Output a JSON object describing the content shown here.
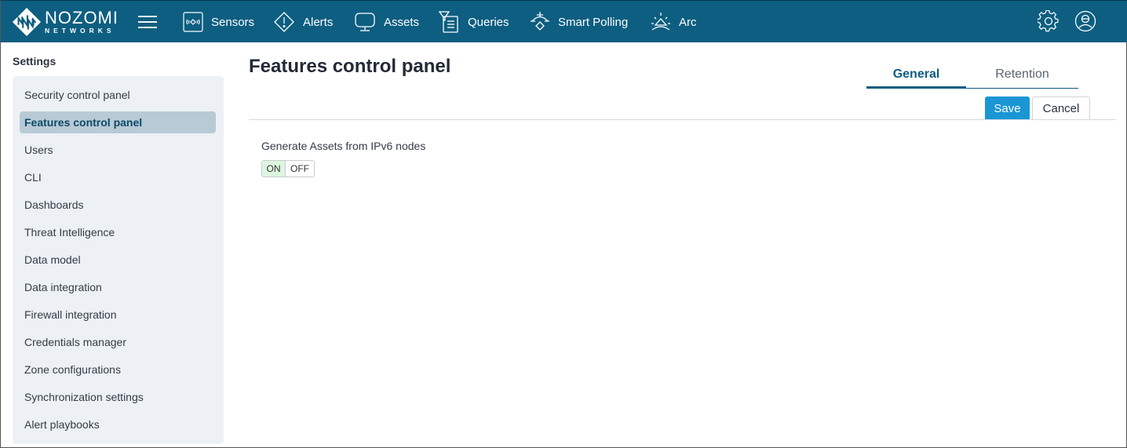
{
  "brand": {
    "line1": "NOZOMI",
    "line2": "NETWORKS"
  },
  "nav": {
    "items": [
      {
        "label": "Sensors",
        "icon": "sensors-icon"
      },
      {
        "label": "Alerts",
        "icon": "alert-diamond-icon"
      },
      {
        "label": "Assets",
        "icon": "monitor-icon"
      },
      {
        "label": "Queries",
        "icon": "query-filter-icon"
      },
      {
        "label": "Smart Polling",
        "icon": "smart-polling-icon"
      },
      {
        "label": "Arc",
        "icon": "arc-icon"
      }
    ],
    "right_icons": [
      "gear-icon",
      "user-avatar-icon"
    ]
  },
  "sidebar": {
    "title": "Settings",
    "active_index": 1,
    "items": [
      {
        "label": "Security control panel"
      },
      {
        "label": "Features control panel"
      },
      {
        "label": "Users"
      },
      {
        "label": "CLI"
      },
      {
        "label": "Dashboards"
      },
      {
        "label": "Threat Intelligence"
      },
      {
        "label": "Data model"
      },
      {
        "label": "Data integration"
      },
      {
        "label": "Firewall integration"
      },
      {
        "label": "Credentials manager"
      },
      {
        "label": "Zone configurations"
      },
      {
        "label": "Synchronization settings"
      },
      {
        "label": "Alert playbooks"
      }
    ]
  },
  "main": {
    "title": "Features control panel",
    "tabs": [
      {
        "label": "General",
        "active": true
      },
      {
        "label": "Retention",
        "active": false
      }
    ],
    "save_label": "Save",
    "cancel_label": "Cancel",
    "settings": [
      {
        "label": "Generate Assets from IPv6 nodes",
        "toggle": {
          "on_label": "ON",
          "off_label": "OFF",
          "value": "ON"
        }
      }
    ]
  },
  "colors": {
    "topbar": "#0d5e80",
    "accent": "#1a96d4",
    "active_side": "#b8cad6",
    "toggle_on": "#def5df"
  }
}
